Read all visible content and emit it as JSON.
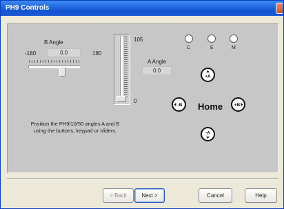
{
  "window": {
    "title": "PH9 Controls"
  },
  "b_angle": {
    "label": "B Angle",
    "value": "0.0",
    "min": "-180",
    "max": "180",
    "position": 0.5
  },
  "a_angle": {
    "label": "A Angle",
    "value": "0.0",
    "max_label": "105",
    "min_label": "0",
    "position": 0.0
  },
  "indicators": [
    {
      "label": "C"
    },
    {
      "label": "E"
    },
    {
      "label": "M"
    }
  ],
  "jog": {
    "home_label": "Home",
    "a_plus": "+A",
    "a_minus": "-A",
    "b_minus": "-B",
    "b_plus": "+B"
  },
  "instructions": "Position the PH9/10/50 angles A and B using the buttons, keypad or sliders.",
  "buttons": {
    "back": "< Back",
    "next": "Next >",
    "cancel": "Cancel",
    "help": "Help"
  }
}
